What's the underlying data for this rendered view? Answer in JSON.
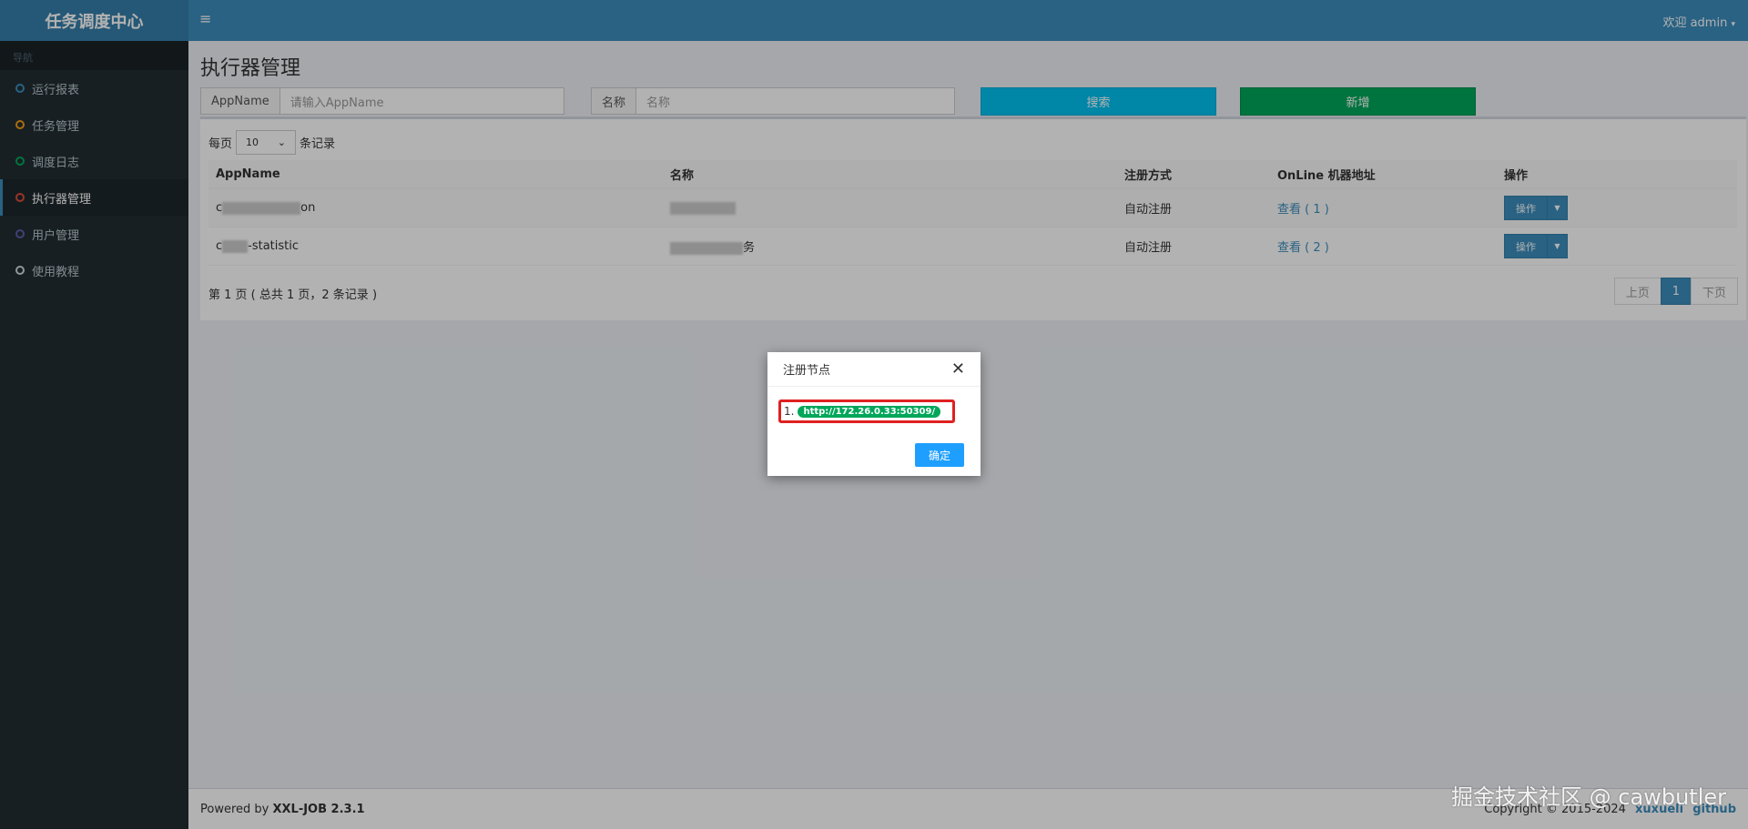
{
  "sidebar": {
    "logo": "任务调度中心",
    "nav_header": "导航",
    "items": [
      {
        "label": "运行报表",
        "color": "#3c8dbc"
      },
      {
        "label": "任务管理",
        "color": "#f39c12"
      },
      {
        "label": "调度日志",
        "color": "#00a65a"
      },
      {
        "label": "执行器管理",
        "color": "#dd4b39"
      },
      {
        "label": "用户管理",
        "color": "#605ca8"
      },
      {
        "label": "使用教程",
        "color": "#d2d6de"
      }
    ]
  },
  "header": {
    "user": "欢迎 admin"
  },
  "page": {
    "title": "执行器管理",
    "filters": {
      "appname_label": "AppName",
      "appname_placeholder": "请输入AppName",
      "name_label": "名称",
      "name_placeholder": "名称",
      "search_button": "搜索",
      "add_button": "新增"
    },
    "length": {
      "prefix": "每页",
      "value": "10",
      "suffix": "条记录"
    },
    "table": {
      "headers": [
        "AppName",
        "名称",
        "注册方式",
        "OnLine 机器地址",
        "操作"
      ],
      "rows": [
        {
          "appname_start": "c",
          "appname_end": "on",
          "name": "",
          "reg": "自动注册",
          "online": "查看 ( 1 )",
          "op": "操作"
        },
        {
          "appname_start": "c",
          "appname_end": "-statistic",
          "name": "务",
          "reg": "自动注册",
          "online": "查看 ( 2 )",
          "op": "操作"
        }
      ]
    },
    "info": "第 1 页 ( 总共 1 页，2 条记录 )",
    "pager": {
      "prev": "上页",
      "current": "1",
      "next": "下页"
    }
  },
  "footer": {
    "powered": "Powered by",
    "product": "XXL-JOB 2.3.1",
    "copyright": "Copyright © 2015-2024",
    "author": "xuxueli",
    "github": "github"
  },
  "modal": {
    "title": "注册节点",
    "node_index": "1.",
    "node_address": "http://172.26.0.33:50309/",
    "ok_button": "确定"
  },
  "watermark": "掘金技术社区 @ cawbutler"
}
